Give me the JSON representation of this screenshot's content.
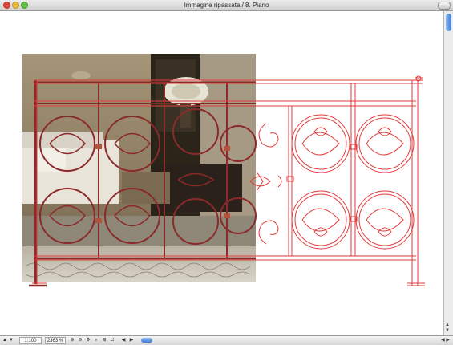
{
  "window": {
    "title": "Immagine ripassata / 8. Piano"
  },
  "statusbar": {
    "zoom_value": "1:100",
    "percent_value": "2363 %",
    "nav_up": "▲",
    "nav_down": "▼",
    "arrow_left": "◀",
    "arrow_right": "▶",
    "tool_icons": [
      "⊕",
      "⊖",
      "✥",
      "⌕",
      "⊞",
      "⇄"
    ]
  },
  "scrollbar": {
    "up": "▲",
    "down": "▼"
  },
  "colors": {
    "railing_red": "#d23a3a",
    "photo_wall": "#8a7a60",
    "floor": "#c7c1b5"
  },
  "icons": {
    "close": "close-button",
    "minimize": "minimize-button",
    "zoom": "zoom-button"
  }
}
